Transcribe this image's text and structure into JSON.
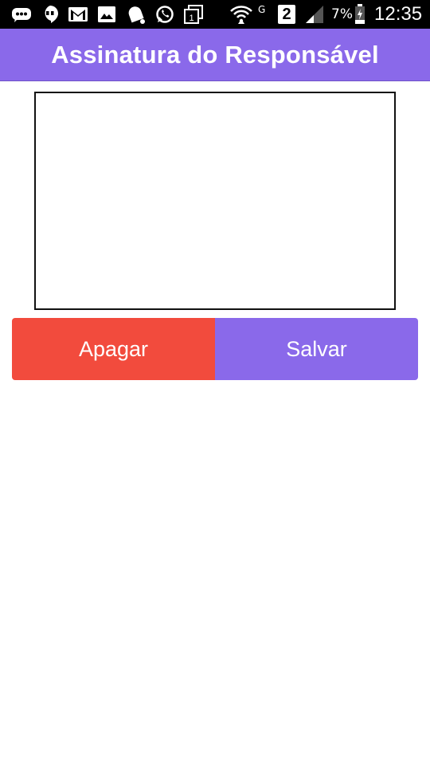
{
  "status_bar": {
    "icons_left": [
      "chat-bubbles-icon",
      "hangouts-icon",
      "gmail-icon",
      "gallery-icon",
      "notification-bell-icon",
      "whatsapp-icon",
      "calendar-icon"
    ],
    "icons_right": [
      "wifi-icon",
      "sim-2-icon",
      "signal-icon",
      "battery-icon"
    ],
    "network_label": "G",
    "sim_label": "2",
    "battery_percent": "7%",
    "time": "12:35"
  },
  "app_bar": {
    "title": "Assinatura do Responsável",
    "background": "#8a69ea"
  },
  "actions": {
    "clear_label": "Apagar",
    "clear_color": "#f24b3d",
    "save_label": "Salvar",
    "save_color": "#8a69ea"
  }
}
